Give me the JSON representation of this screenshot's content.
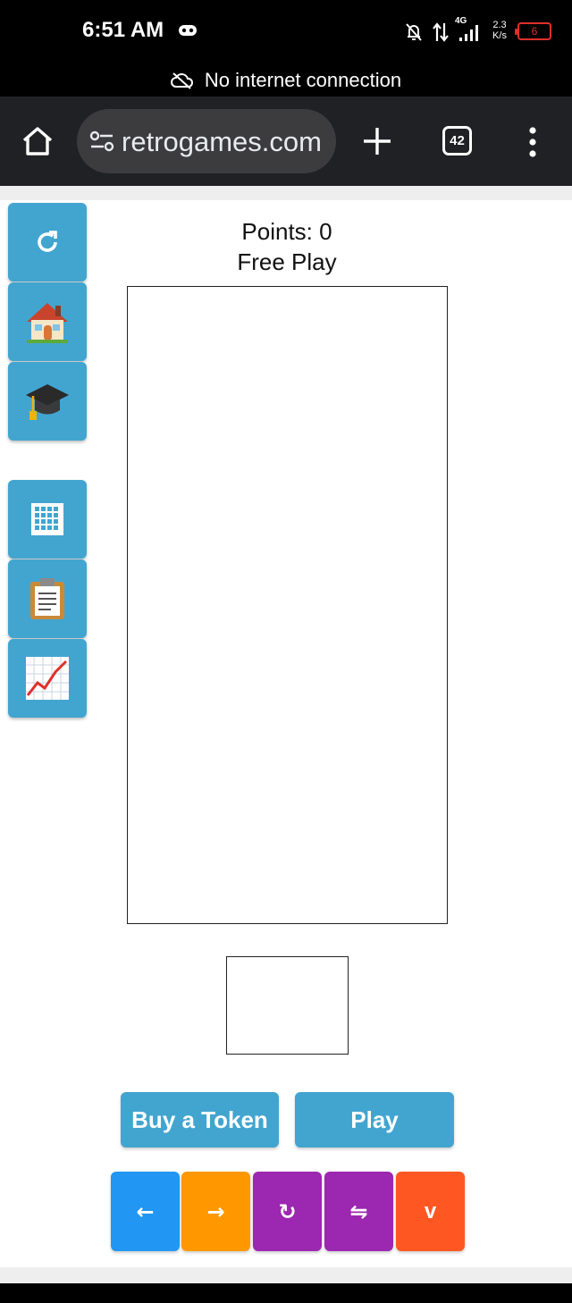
{
  "status_bar": {
    "time": "6:51 AM",
    "network": "4G",
    "speed_value": "2.3",
    "speed_unit": "K/s",
    "battery_level": "6",
    "battery_color": "#e0302a"
  },
  "banner": {
    "text": "No internet connection",
    "icon": "cloud-off-icon"
  },
  "browser": {
    "url": "retrogames.com",
    "tab_count": "42",
    "background": "#202124"
  },
  "sidebar": {
    "accent": "#42a5d0",
    "items": [
      {
        "name": "restart",
        "icon": "refresh-icon"
      },
      {
        "name": "home",
        "icon": "house-icon"
      },
      {
        "name": "tutorial",
        "icon": "graduation-cap-icon"
      },
      {
        "name": "grid",
        "icon": "grid-icon"
      },
      {
        "name": "clipboard",
        "icon": "clipboard-icon"
      },
      {
        "name": "stats",
        "icon": "chart-icon"
      }
    ]
  },
  "game": {
    "points_label": "Points: 0",
    "mode": "Free Play"
  },
  "actions": {
    "buy_label": "Buy a Token",
    "play_label": "Play"
  },
  "controls": [
    {
      "name": "left",
      "label": "←",
      "color": "#2196f3"
    },
    {
      "name": "right",
      "label": "→",
      "color": "#ff9800"
    },
    {
      "name": "rotate",
      "label": "↻",
      "color": "#9c27b0"
    },
    {
      "name": "swap",
      "label": "⇋",
      "color": "#9c27b0"
    },
    {
      "name": "down",
      "label": "v",
      "color": "#ff5722"
    }
  ]
}
